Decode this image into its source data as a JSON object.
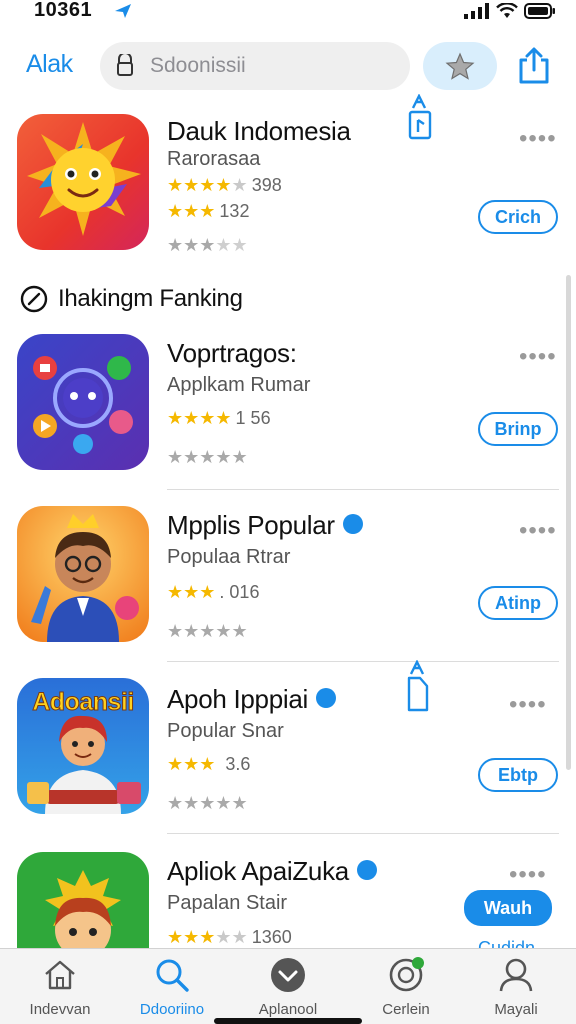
{
  "status": {
    "time": "10361"
  },
  "header": {
    "back_label": "Alak",
    "search_placeholder": "Sdoonissii"
  },
  "section": {
    "title": "Ihakingm Fanking"
  },
  "apps": [
    {
      "title": "Dauk Indomesia",
      "subtitle": "Rarorasaa",
      "rating_count": "398",
      "secondary_count": "132",
      "button": "Crich",
      "verified": false
    },
    {
      "title": "Voprtragos:",
      "subtitle": "Applkam Rumar",
      "rating_count": "1 56",
      "button": "Brinp",
      "verified": false,
      "icon_label": ""
    },
    {
      "title": "Mpplis Popular",
      "subtitle": "Populaa Rtrar",
      "rating_count": ". 016",
      "button": "Atinp",
      "verified": true
    },
    {
      "title": "Apoh Ipppiai",
      "subtitle": "Popular Snar",
      "rating_count": "3.6",
      "button": "Ebtp",
      "verified": true,
      "icon_banner": "Adoansii"
    },
    {
      "title": "Apliok ApaiZuka",
      "subtitle": "Papalan Stair",
      "rating_count": "1360",
      "button": "Wauh",
      "verified": true,
      "extra_link": "Cudidn"
    }
  ],
  "tabs": [
    {
      "label": "Indevvan",
      "icon": "home-icon"
    },
    {
      "label": "Ddooriino",
      "icon": "search-icon",
      "active": true
    },
    {
      "label": "Aplanool",
      "icon": "download-icon"
    },
    {
      "label": "Cerlein",
      "icon": "arcade-icon"
    },
    {
      "label": "Mayali",
      "icon": "person-icon"
    }
  ],
  "colors": {
    "accent": "#1a8ce8",
    "star": "#f5b800"
  }
}
